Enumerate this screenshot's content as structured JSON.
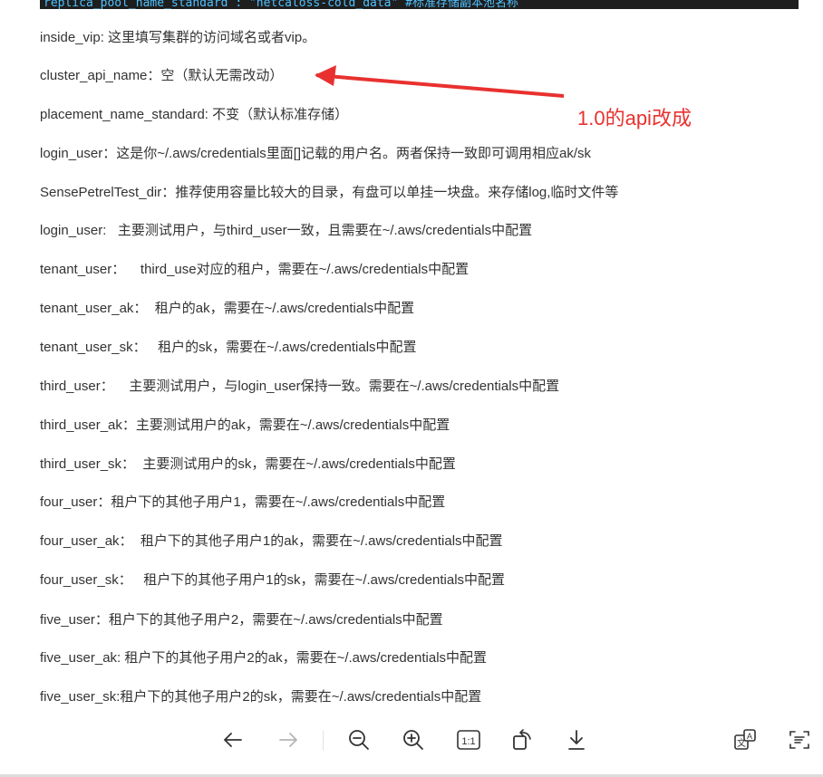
{
  "code_strip": {
    "text": "replica_pool_name_standard : \"netcaloss-cold_data\"    #标准存储副本池名称"
  },
  "lines": [
    "inside_vip: 这里填写集群的访问域名或者vip。",
    "cluster_api_name：空（默认无需改动）",
    "placement_name_standard: 不变（默认标准存储）",
    "login_user：这是你~/.aws/credentials里面[]记载的用户名。两者保持一致即可调用相应ak/sk",
    "SensePetrelTest_dir：推荐使用容量比较大的目录，有盘可以单挂一块盘。来存储log,临时文件等",
    "login_user:   主要测试用户，与third_user一致，且需要在~/.aws/credentials中配置",
    "tenant_user：    third_use对应的租户，需要在~/.aws/credentials中配置",
    "tenant_user_ak：  租户的ak，需要在~/.aws/credentials中配置",
    "tenant_user_sk：   租户的sk，需要在~/.aws/credentials中配置",
    "third_user：    主要测试用户，与login_user保持一致。需要在~/.aws/credentials中配置",
    "third_user_ak：主要测试用户的ak，需要在~/.aws/credentials中配置",
    "third_user_sk：  主要测试用户的sk，需要在~/.aws/credentials中配置",
    "four_user：租户下的其他子用户1，需要在~/.aws/credentials中配置",
    "four_user_ak：  租户下的其他子用户1的ak，需要在~/.aws/credentials中配置",
    "four_user_sk：   租户下的其他子用户1的sk，需要在~/.aws/credentials中配置",
    "five_user：租户下的其他子用户2，需要在~/.aws/credentials中配置",
    "five_user_ak: 租户下的其他子用户2的ak，需要在~/.aws/credentials中配置",
    "five_user_sk:租户下的其他子用户2的sk，需要在~/.aws/credentials中配置"
  ],
  "annotation": {
    "text": "1.0的api改成",
    "color": "#e8312f"
  },
  "toolbar": {
    "previous": "arrow-left-icon",
    "next": "arrow-right-icon",
    "zoom_out": "zoom-out-icon",
    "zoom_in": "zoom-in-icon",
    "actual_size_label": "1:1",
    "rotate": "rotate-icon",
    "download": "download-icon",
    "translate": "translate-icon",
    "extract_text": "text-extract-icon"
  }
}
